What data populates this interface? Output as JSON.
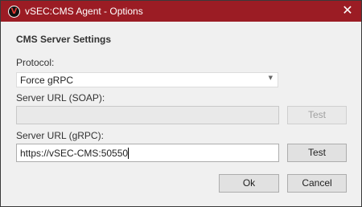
{
  "window": {
    "title": "vSEC:CMS Agent - Options",
    "app_icon_glyph": "V",
    "close_glyph": "✕",
    "accent_color": "#9b1c24"
  },
  "section": {
    "title": "CMS Server Settings"
  },
  "protocol": {
    "label": "Protocol:",
    "selected": "Force gRPC",
    "arrow": "▼"
  },
  "soap": {
    "label": "Server URL (SOAP):",
    "value": "",
    "enabled": false,
    "test_label": "Test"
  },
  "grpc": {
    "label": "Server URL (gRPC):",
    "value": "https://vSEC-CMS:50550",
    "test_label": "Test"
  },
  "footer": {
    "ok_label": "Ok",
    "cancel_label": "Cancel"
  }
}
